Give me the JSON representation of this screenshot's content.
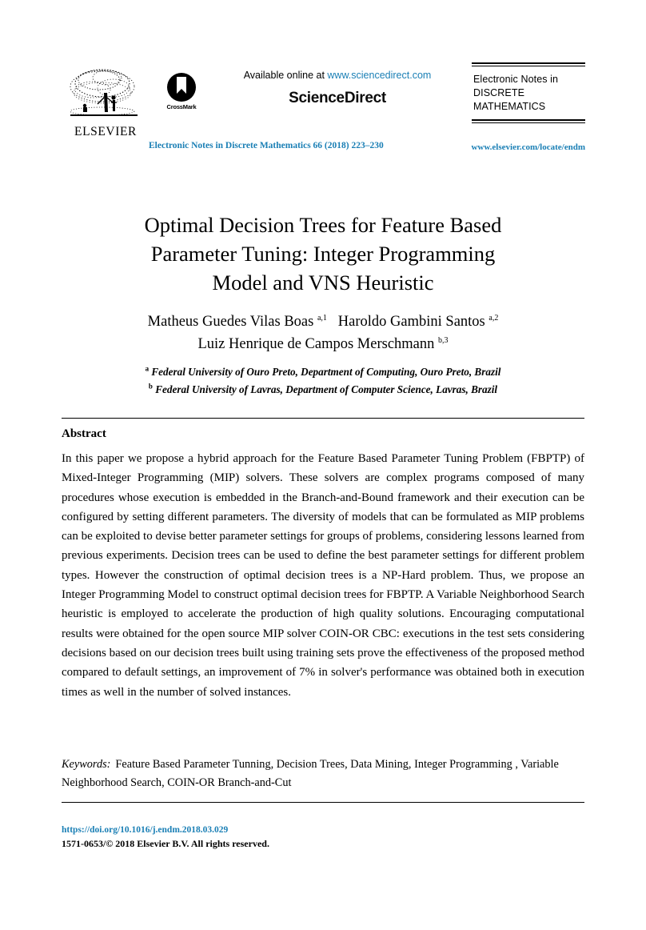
{
  "masthead": {
    "publisher_logo_name": "ELSEVIER",
    "crossmark_label": "CrossMark",
    "available_prefix": "Available online at ",
    "available_link": "www.sciencedirect.com",
    "platform_name_part1": "Science",
    "platform_name_part2": "Direct",
    "journal_logo": {
      "line1": "Electronic Notes in",
      "line2": "DISCRETE",
      "line3": "MATHEMATICS"
    },
    "journal_reference": "Electronic Notes in Discrete Mathematics 66 (2018) 223–230",
    "journal_url": "www.elsevier.com/locate/endm"
  },
  "title": {
    "line1": "Optimal Decision Trees for Feature Based",
    "line2": "Parameter Tuning: Integer Programming",
    "line3": "Model and VNS Heuristic"
  },
  "authors": {
    "line1": [
      {
        "name": "Matheus Guedes Vilas Boas",
        "marks": "a,1"
      },
      {
        "name": "Haroldo Gambini Santos",
        "marks": "a,2"
      }
    ],
    "line2": [
      {
        "name": "Luiz Henrique de Campos Merschmann",
        "marks": "b,3"
      }
    ]
  },
  "affiliations": [
    {
      "mark": "a",
      "text": "Federal University of Ouro Preto, Department of Computing, Ouro Preto, Brazil"
    },
    {
      "mark": "b",
      "text": "Federal University of Lavras, Department of Computer Science, Lavras, Brazil"
    }
  ],
  "abstract": {
    "heading": "Abstract",
    "text": "In this paper we propose a hybrid approach for the Feature Based Parameter Tuning Problem (FBPTP) of Mixed-Integer Programming (MIP) solvers. These solvers are complex programs composed of many procedures whose execution is embedded in the Branch-and-Bound framework and their execution can be configured by setting different parameters. The diversity of models that can be formulated as MIP problems can be exploited to devise better parameter settings for groups of problems, considering lessons learned from previous experiments. Decision trees can be used to define the best parameter settings for different problem types. However the construction of optimal decision trees is a NP-Hard problem. Thus, we propose an Integer Programming Model to construct optimal decision trees for FBPTP. A Variable Neighborhood Search heuristic is employed to accelerate the production of high quality solutions. Encouraging computational results were obtained for the open source MIP solver COIN-OR CBC: executions in the test sets considering decisions based on our decision trees built using training sets prove the effectiveness of the proposed method compared to default settings, an improvement of 7% in solver's performance was obtained both in execution times as well in the number of solved instances."
  },
  "keywords": {
    "label": "Keywords:",
    "text": "Feature Based Parameter Tunning, Decision Trees, Data Mining, Integer Programming , Variable Neighborhood Search, COIN-OR Branch-and-Cut"
  },
  "footer": {
    "doi": "https://doi.org/10.1016/j.endm.2018.03.029",
    "copyright": "1571-0653/© 2018 Elsevier B.V. All rights reserved."
  },
  "colors": {
    "link_blue": "#1a7fb5",
    "text_black": "#000000",
    "page_background": "#ffffff"
  }
}
